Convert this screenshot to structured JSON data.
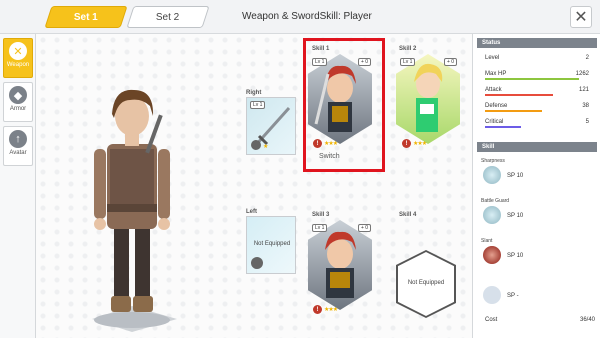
{
  "header": {
    "tab1": "Set 1",
    "tab2": "Set 2",
    "title": "Weapon & SwordSkill: Player",
    "close_icon": "close-icon"
  },
  "nav": [
    {
      "label": "Weapon",
      "icon": "crossed-swords-icon"
    },
    {
      "label": "Armor",
      "icon": "shield-icon"
    },
    {
      "label": "Avatar",
      "icon": "up-arrow-icon"
    }
  ],
  "slots": {
    "right": {
      "label": "Right",
      "lv": "Lv 1"
    },
    "left": {
      "label": "Left",
      "empty_text": "Not Equipped"
    },
    "skill1": {
      "label": "Skill 1",
      "lv": "Lv 1",
      "plus": "+ 0",
      "caption": "Switch"
    },
    "skill2": {
      "label": "Skill 2",
      "lv": "Lv 1",
      "plus": "+ 0"
    },
    "skill3": {
      "label": "Skill 3",
      "lv": "Lv 1",
      "plus": "+ 0"
    },
    "skill4": {
      "label": "Skill 4",
      "empty_text": "Not Equipped"
    }
  },
  "status": {
    "title": "Status",
    "rows": [
      {
        "key": "Level",
        "value": "2",
        "bar_color": "#ffffff",
        "fill": 0
      },
      {
        "key": "Max HP",
        "value": "1262",
        "bar_color": "#8dc63f",
        "fill": 0.9
      },
      {
        "key": "Attack",
        "value": "121",
        "bar_color": "#e74c3c",
        "fill": 0.65
      },
      {
        "key": "Defense",
        "value": "38",
        "bar_color": "#f39c12",
        "fill": 0.55
      },
      {
        "key": "Critical",
        "value": "5",
        "bar_color": "#6c5ce7",
        "fill": 0.35
      }
    ]
  },
  "skill": {
    "title": "Skill",
    "items": [
      {
        "name": "Sharpness",
        "sp": "SP 10"
      },
      {
        "name": "Battle Guard",
        "sp": "SP 10"
      },
      {
        "name": "Slant",
        "sp": "SP 10"
      },
      {
        "name": "",
        "sp": "SP -"
      }
    ]
  },
  "cost": {
    "label": "Cost",
    "value": "36/40"
  },
  "colors": {
    "accent": "#f6c21b",
    "highlight": "#e0141e"
  }
}
